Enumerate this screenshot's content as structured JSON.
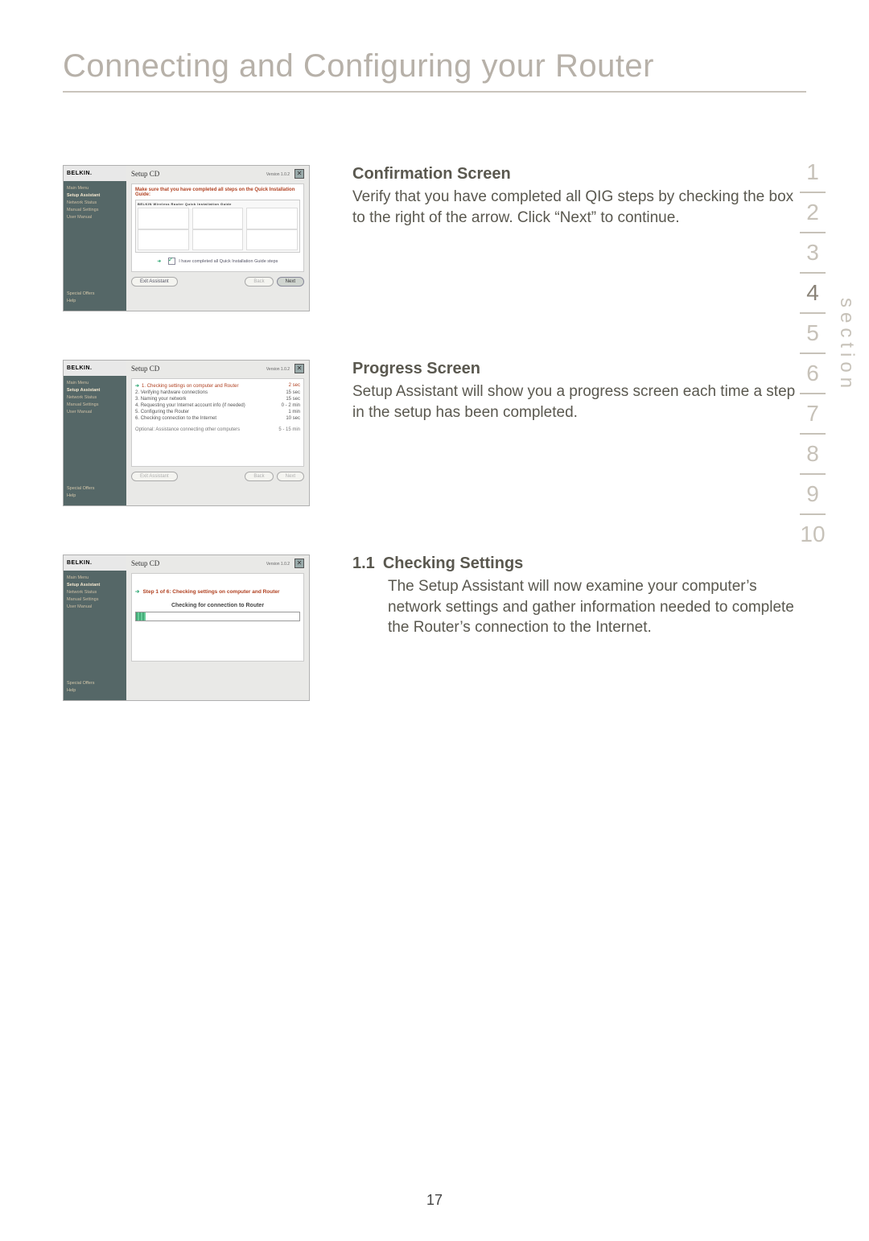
{
  "page_title": "Connecting and Configuring your Router",
  "page_number": "17",
  "section_label": "section",
  "section_nav": {
    "active": 4,
    "items": [
      "1",
      "2",
      "3",
      "4",
      "5",
      "6",
      "7",
      "8",
      "9",
      "10"
    ]
  },
  "block1": {
    "heading": "Confirmation Screen",
    "body": "Verify that you have completed all QIG steps by checking the box to the right of the arrow. Click “Next” to continue."
  },
  "block2": {
    "heading": "Progress Screen",
    "body": "Setup Assistant will show you a progress screen each time a step in the setup has been completed."
  },
  "block3": {
    "num": "1.1",
    "heading": "Checking Settings",
    "body": "The Setup Assistant will now examine your computer’s network settings and gather information needed to complete the Router’s connection to the Internet."
  },
  "shot_common": {
    "brand": "BELKIN.",
    "title": "Setup CD",
    "version": "Version 1.0.2",
    "close": "✕",
    "nav": {
      "main_menu": "Main Menu",
      "setup_assistant": "Setup Assistant",
      "network_status": "Network Status",
      "manual_settings": "Manual Settings",
      "user_manual": "User Manual"
    },
    "bottom": {
      "special_offers": "Special Offers",
      "help": "Help"
    },
    "buttons": {
      "exit": "Exit Assistant",
      "back": "Back",
      "next": "Next"
    }
  },
  "shot1": {
    "instr": "Make sure that you have completed all steps on the Quick Installation Guide:",
    "qig_header": "BELKIN    Wireless Router    Quick Installation Guide",
    "confirm_text": "I have completed all Quick Installation Guide steps"
  },
  "shot2": {
    "steps": [
      {
        "n": "1",
        "label": "Checking settings on computer and Router",
        "time": "2 sec",
        "active": true
      },
      {
        "n": "2",
        "label": "Verifying hardware connections",
        "time": "15 sec"
      },
      {
        "n": "3",
        "label": "Naming your network",
        "time": "15 sec"
      },
      {
        "n": "4",
        "label": "Requesting your Internet account info (if needed)",
        "time": "0 - 2 min"
      },
      {
        "n": "5",
        "label": "Configuring the Router",
        "time": "1 min"
      },
      {
        "n": "6",
        "label": "Checking connection to the Internet",
        "time": "10 sec"
      }
    ],
    "optional": {
      "label": "Optional: Assistance connecting other computers",
      "time": "5 - 15 min"
    }
  },
  "shot3": {
    "step_line": "Step 1 of 6: Checking settings on computer and Router",
    "checking": "Checking for connection to Router"
  }
}
